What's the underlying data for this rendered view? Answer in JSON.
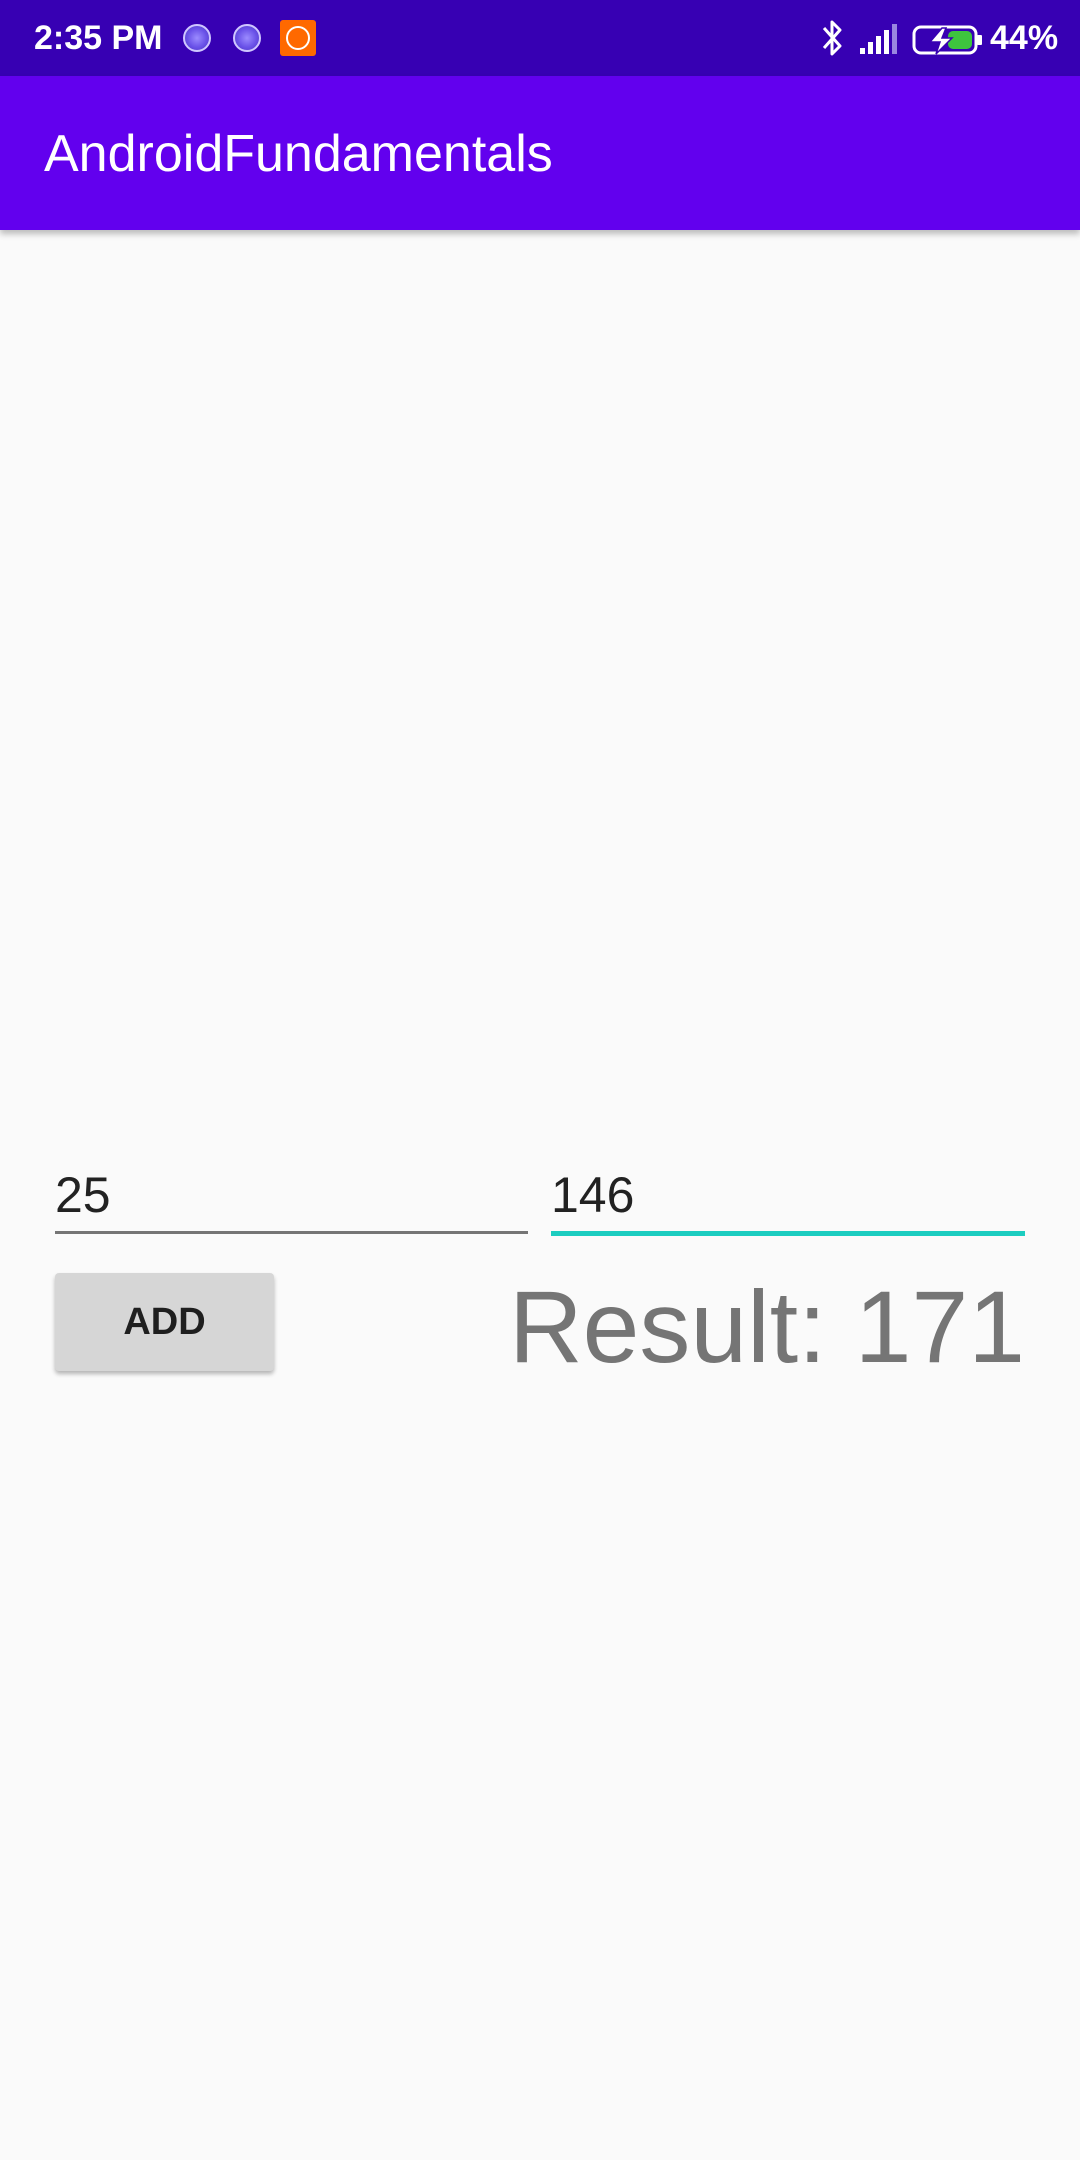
{
  "status_bar": {
    "time": "2:35 PM",
    "icons": [
      "notification-icon",
      "notification-icon",
      "mi-icon",
      "bluetooth-icon",
      "signal-icon",
      "battery-charging-icon"
    ],
    "battery_percent": "44%"
  },
  "app_bar": {
    "title": "AndroidFundamentals",
    "background_color": "#6200ee"
  },
  "form": {
    "first_number": "25",
    "second_number": "146",
    "add_button_label": "ADD",
    "result": "Result: 171",
    "focus_underline_color": "#1ccdc0"
  }
}
